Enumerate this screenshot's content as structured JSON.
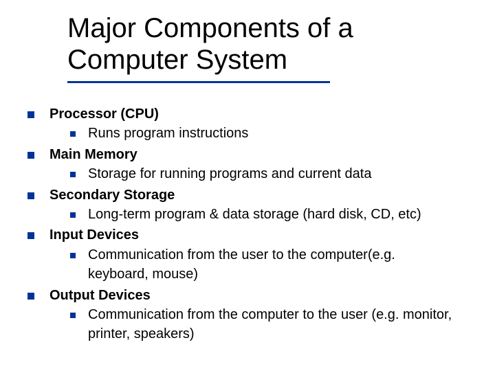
{
  "title_line1": "Major Components of a",
  "title_line2": "Computer System",
  "items": [
    {
      "heading": "Processor (CPU)",
      "sub": "Runs program instructions"
    },
    {
      "heading": "Main Memory",
      "sub": "Storage for running programs and current data"
    },
    {
      "heading": "Secondary Storage",
      "sub": "Long-term program & data storage (hard disk, CD, etc)"
    },
    {
      "heading": "Input Devices",
      "sub": "Communication from the user to the computer(e.g. keyboard, mouse)"
    },
    {
      "heading": "Output Devices",
      "sub": "Communication from the computer to the user (e.g. monitor, printer, speakers)"
    }
  ]
}
